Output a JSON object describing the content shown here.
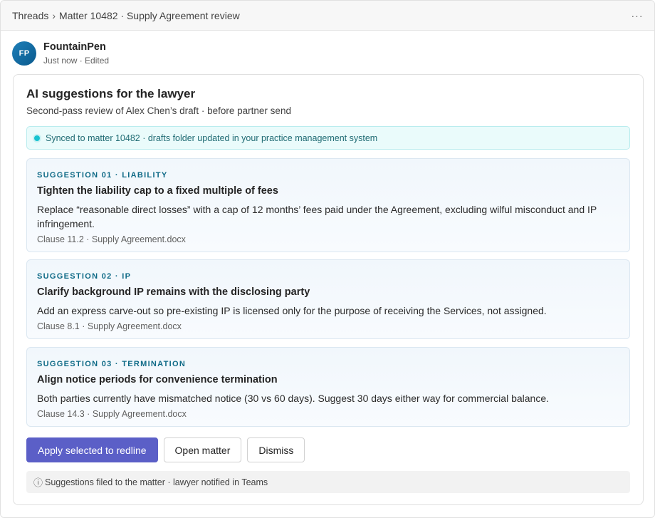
{
  "breadcrumb": [
    "Threads",
    "Matter 10482 · Supply Agreement review"
  ],
  "breadcrumb_separator": "›",
  "more_icon": "···",
  "message": {
    "avatar_initials": "FP",
    "sender": "FountainPen",
    "meta": "Just now · Edited"
  },
  "card": {
    "title": "AI suggestions for the lawyer",
    "subtitle": "Second-pass review of Alex Chen’s draft · before partner send",
    "sync_status": "Synced to matter 10482 · drafts folder updated in your practice management system",
    "suggestions": [
      {
        "eyebrow": "SUGGESTION 01 · LIABILITY",
        "title": "Tighten the liability cap to a fixed multiple of fees",
        "body": "Replace “reasonable direct losses” with a cap of 12 months’ fees paid under the Agreement, excluding wilful misconduct and IP infringement.",
        "reference": "Clause 11.2 · Supply Agreement.docx"
      },
      {
        "eyebrow": "SUGGESTION 02 · IP",
        "title": "Clarify background IP remains with the disclosing party",
        "body": "Add an express carve-out so pre-existing IP is licensed only for the purpose of receiving the Services, not assigned.",
        "reference": "Clause 8.1 · Supply Agreement.docx"
      },
      {
        "eyebrow": "SUGGESTION 03 · TERMINATION",
        "title": "Align notice periods for convenience termination",
        "body": "Both parties currently have mismatched notice (30 vs 60 days). Suggest 30 days either way for commercial balance.",
        "reference": "Clause 14.3 · Supply Agreement.docx"
      }
    ],
    "actions": {
      "primary": "Apply selected to redline",
      "open": "Open matter",
      "dismiss": "Dismiss"
    },
    "info_icon": "ⓘ",
    "footer": "Suggestions filed to the matter · lawyer notified in Teams"
  },
  "colors": {
    "accent": "#5b5fc7",
    "sync_background": "#eafbfb",
    "sync_dot": "#17c3d0",
    "eyebrow": "#0e6a86",
    "avatar": "#1f7fb8"
  }
}
